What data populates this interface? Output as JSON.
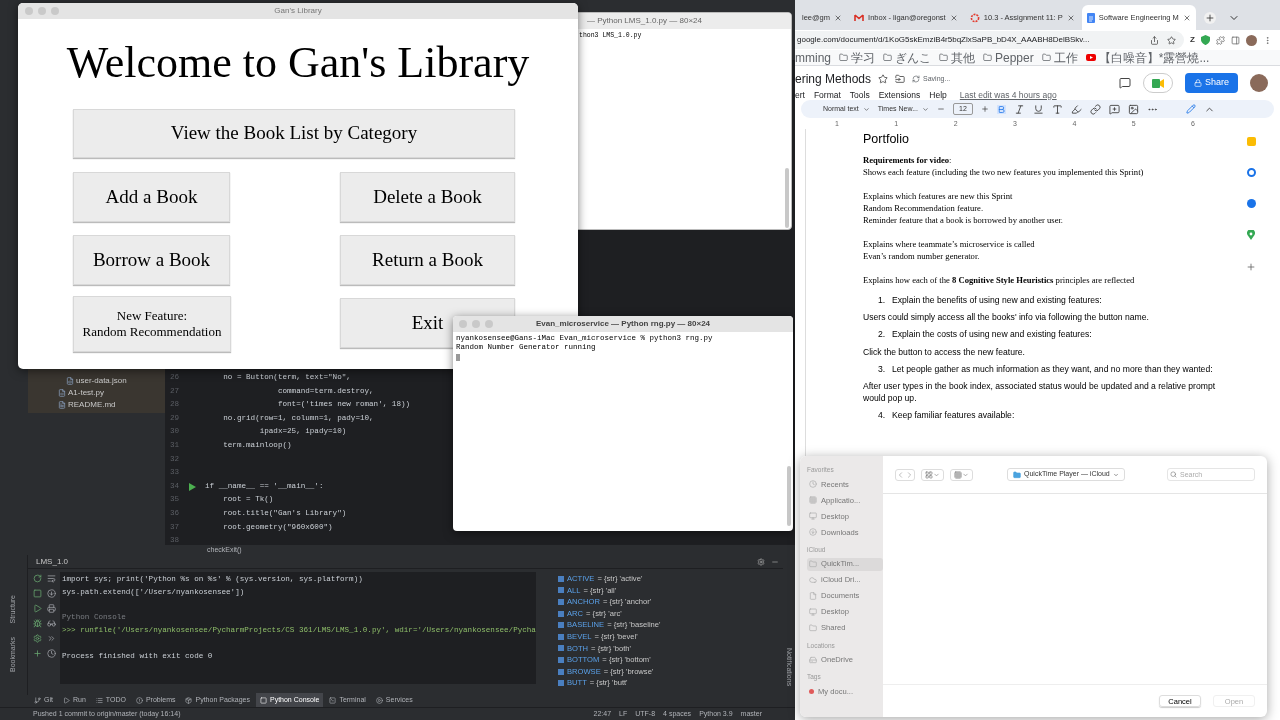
{
  "ide": {
    "project_files": [
      "user-data.json",
      "A1-test.py",
      "README.md"
    ],
    "code_lines": [
      {
        "number": "26",
        "text": "    no = Button(term, text=\"No\",",
        "runnable": false
      },
      {
        "number": "27",
        "text": "                command=term.destroy,",
        "runnable": false
      },
      {
        "number": "28",
        "text": "                font=('times new roman', 18))",
        "runnable": false
      },
      {
        "number": "29",
        "text": "    no.grid(row=1, column=1, pady=10,",
        "runnable": false
      },
      {
        "number": "30",
        "text": "            ipadx=25, ipady=10)",
        "runnable": false
      },
      {
        "number": "31",
        "text": "    term.mainloop()",
        "runnable": false
      },
      {
        "number": "32",
        "runnable": false
      },
      {
        "number": "33",
        "runnable": false
      },
      {
        "number": "34",
        "text": "if __name__ == '__main__':",
        "runnable": true
      },
      {
        "number": "35",
        "text": "    root = Tk()",
        "runnable": false
      },
      {
        "number": "36",
        "text": "    root.title(\"Gan's Library\")",
        "runnable": false
      },
      {
        "number": "37",
        "text": "    root.geometry(\"960x600\")",
        "runnable": false
      },
      {
        "number": "38",
        "runnable": false
      }
    ],
    "breadcrumb": "checkExit()",
    "console_tab": "LMS_1.0",
    "console_lines": [
      {
        "kind": "code",
        "text": "import sys; print('Python %s on %s' % (sys.version, sys.platform))"
      },
      {
        "kind": "code",
        "text": "sys.path.extend(['/Users/nyankosensee'])"
      },
      {
        "kind": "blank"
      },
      {
        "kind": "header",
        "text": "Python Console"
      },
      {
        "kind": "prompt",
        "text": ">>> runfile('/Users/nyankosensee/PycharmProjects/CS 361/LMS/LMS_1.0.py', wdir='/Users/nyankosensee/Pycha"
      },
      {
        "kind": "blank"
      },
      {
        "kind": "code",
        "text": "Process finished with exit code 0"
      }
    ],
    "variables": [
      {
        "name": "ACTIVE",
        "value": "= {str} 'active'"
      },
      {
        "name": "ALL",
        "value": "= {str} 'all'"
      },
      {
        "name": "ANCHOR",
        "value": "= {str} 'anchor'"
      },
      {
        "name": "ARC",
        "value": "= {str} 'arc'"
      },
      {
        "name": "BASELINE",
        "value": "= {str} 'baseline'"
      },
      {
        "name": "BEVEL",
        "value": "= {str} 'bevel'"
      },
      {
        "name": "BOTH",
        "value": "= {str} 'both'"
      },
      {
        "name": "BOTTOM",
        "value": "= {str} 'bottom'"
      },
      {
        "name": "BROWSE",
        "value": "= {str} 'browse'"
      },
      {
        "name": "BUTT",
        "value": "= {str} 'butt'"
      }
    ],
    "side_labels": [
      "Structure",
      "Bookmarks"
    ],
    "right_label": "Notifications",
    "tool_tabs": [
      {
        "kind": "git",
        "label": "Git",
        "selected": false
      },
      {
        "kind": "run",
        "label": "Run",
        "selected": false
      },
      {
        "kind": "todo",
        "label": "TODO",
        "selected": false
      },
      {
        "kind": "problems",
        "label": "Problems",
        "selected": false
      },
      {
        "kind": "packages",
        "label": "Python Packages",
        "selected": false
      },
      {
        "kind": "console",
        "label": "Python Console",
        "selected": true
      },
      {
        "kind": "terminal",
        "label": "Terminal",
        "selected": false
      },
      {
        "kind": "services",
        "label": "Services",
        "selected": false
      }
    ],
    "status_bar": {
      "message": "Pushed 1 commit to origin/master (today 16:14)",
      "items": [
        "22:47",
        "LF",
        "UTF-8",
        "4 spaces",
        "Python 3.9",
        "master"
      ]
    }
  },
  "terminal_lms": {
    "title": "— Python LMS_1.0.py — 80×24",
    "lines": [
      "thon3 LMS_1.0.py"
    ]
  },
  "tk_app": {
    "title": "Gan's Library",
    "heading": "Welcome to Gan's Library",
    "wide_button": "View the Book List by Category",
    "buttons": [
      "Add a Book",
      "Delete a Book",
      "Borrow a Book",
      "Return a Book",
      "New Feature:\nRandom Recommendation",
      "Exit"
    ]
  },
  "terminal_rng": {
    "title": "Evan_microservice — Python rng.py — 80×24",
    "lines": [
      "nyankosensee@Gans-iMac Evan_microservice % python3 rng.py",
      "Random Number Generator running"
    ]
  },
  "browser": {
    "tabs": [
      {
        "kind": "plain",
        "label": "lee@gm",
        "selected": false
      },
      {
        "kind": "mail",
        "label": "Inbox - ligan@oregonst",
        "selected": false
      },
      {
        "kind": "course",
        "label": "10.3 - Assignment 11: P",
        "selected": false
      },
      {
        "kind": "doc",
        "label": "Software Engineering M",
        "selected": true
      }
    ],
    "url": "google.com/document/d/1KoG5skEmziB4r5bqZlxSaPB_bD4X_AAABH8DelBSkv...",
    "extension_letter": "Z",
    "bookmarks": [
      {
        "kind": "text",
        "label": "mming"
      },
      {
        "kind": "folder",
        "label": "学习"
      },
      {
        "kind": "folder",
        "label": "ぎんこ"
      },
      {
        "kind": "folder",
        "label": "其他"
      },
      {
        "kind": "folder",
        "label": "Pepper"
      },
      {
        "kind": "folder",
        "label": "工作"
      },
      {
        "kind": "video",
        "label": "【白噪音】*露營燒..."
      }
    ],
    "doc": {
      "title": "ering Methods",
      "status": "Saving...",
      "menu": [
        "ert",
        "Format",
        "Tools",
        "Extensions",
        "Help"
      ],
      "last_edit": "Last edit was 4 hours ago",
      "share": "Share",
      "toolbar": {
        "style": "Normal text",
        "font": "Times New...",
        "size": "12"
      },
      "ruler": [
        "1",
        "1",
        "2",
        "3",
        "4",
        "5",
        "6"
      ],
      "blocks": [
        {
          "kind": "heading",
          "lines": [
            "Portfolio"
          ]
        },
        {
          "kind": "serif",
          "lines": [
            "**Requirements for video**:",
            "Shows each feature (including the two new features you implemented this Sprint)"
          ]
        },
        {
          "kind": "serif",
          "lines": [
            "Explains which features are new this Sprint",
            "Random Recommendation feature.",
            "Reminder feature that a book is borrowed by another user."
          ]
        },
        {
          "kind": "serif",
          "lines": [
            "Explains where teammate’s microservice is called",
            "Evan’s random number generator."
          ]
        },
        {
          "kind": "serif",
          "lines": [
            "Explains how each of the **8 Cognitive Style Heuristics** principles are reflected"
          ]
        },
        {
          "kind": "numbered",
          "number": "1.",
          "lines": [
            "Explain the benefits of using new and existing features:"
          ]
        },
        {
          "kind": "sans",
          "lines": [
            "Users could simply access all the books' info via following the button name."
          ]
        },
        {
          "kind": "numbered",
          "number": "2.",
          "lines": [
            "Explain the costs of using new and existing features:"
          ]
        },
        {
          "kind": "sans",
          "lines": [
            "Click the button to access the new feature."
          ]
        },
        {
          "kind": "numbered",
          "number": "3.",
          "lines": [
            "Let people gather as much information as they want, and no more than they wanted:"
          ]
        },
        {
          "kind": "sans",
          "lines": [
            "After user types in the book index, associated status would be updated and a relative prompt would pop up."
          ]
        },
        {
          "kind": "numbered",
          "number": "4.",
          "lines": [
            "Keep familiar features available:"
          ]
        }
      ]
    }
  },
  "file_dialog": {
    "sections": [
      {
        "title": "Favorites",
        "items": [
          {
            "kind": "clock",
            "label": "Recents",
            "selected": false
          },
          {
            "kind": "apps",
            "label": "Applicatio...",
            "selected": false
          },
          {
            "kind": "desktop",
            "label": "Desktop",
            "selected": false
          },
          {
            "kind": "download",
            "label": "Downloads",
            "selected": false
          }
        ]
      },
      {
        "title": "iCloud",
        "items": [
          {
            "kind": "folder",
            "label": "QuickTim...",
            "selected": true
          },
          {
            "kind": "cloud",
            "label": "iCloud Dri...",
            "selected": false
          },
          {
            "kind": "file",
            "label": "Documents",
            "selected": false
          },
          {
            "kind": "desktop",
            "label": "Desktop",
            "selected": false
          },
          {
            "kind": "folder",
            "label": "Shared",
            "selected": false
          }
        ]
      },
      {
        "title": "Locations",
        "items": [
          {
            "kind": "drive",
            "label": "OneDrive",
            "selected": false
          }
        ]
      },
      {
        "title": "Tags",
        "items": [
          {
            "kind": "tag",
            "label": "My docu...",
            "selected": false,
            "color": "#e05a5a"
          }
        ]
      }
    ],
    "location": "QuickTime Player — iCloud",
    "search_placeholder": "Search",
    "buttons": [
      {
        "label": "Cancel",
        "disabled": false
      },
      {
        "label": "Open",
        "disabled": true
      }
    ]
  }
}
